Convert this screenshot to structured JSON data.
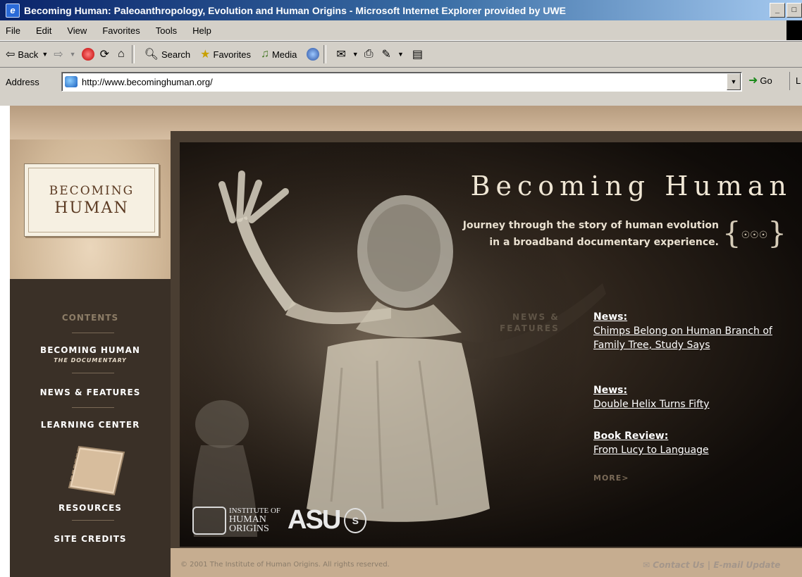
{
  "window": {
    "title": "Becoming Human: Paleoanthropology, Evolution and Human Origins - Microsoft Internet Explorer provided by UWE"
  },
  "menu": [
    "File",
    "Edit",
    "View",
    "Favorites",
    "Tools",
    "Help"
  ],
  "toolbar": {
    "back": "Back",
    "search": "Search",
    "favorites": "Favorites",
    "media": "Media"
  },
  "address": {
    "label": "Address",
    "url": "http://www.becominghuman.org/",
    "go": "Go"
  },
  "site": {
    "logo_line1": "BECOMING",
    "logo_line2": "HUMAN",
    "hero_title": "Becoming Human",
    "tagline_1": "Journey through the story of human evolution",
    "tagline_2": "in a broadband documentary experience.",
    "news_label_1": "NEWS &",
    "news_label_2": "FEATURES",
    "more": "MORE>",
    "copyright": "© 2001 The Institute of Human Origins. All rights reserved.",
    "contact": "Contact Us | E-mail Update"
  },
  "nav": {
    "heading": "CONTENTS",
    "documentary": "BECOMING HUMAN",
    "documentary_sub": "THE DOCUMENTARY",
    "news_features": "NEWS & FEATURES",
    "learning_center": "LEARNING CENTER",
    "resources": "RESOURCES",
    "site_credits": "SITE CREDITS"
  },
  "news": [
    {
      "category": "News:",
      "headline": "Chimps Belong on Human Branch of Family Tree, Study Says"
    },
    {
      "category": "News:",
      "headline": "Double Helix Turns Fifty"
    },
    {
      "category": "Book Review:",
      "headline": "From Lucy to Language"
    }
  ],
  "logos": {
    "iho_1": "INSTITUTE OF",
    "iho_2": "HUMAN",
    "iho_3": "ORIGINS",
    "asu": "ASU",
    "seal": "S"
  }
}
